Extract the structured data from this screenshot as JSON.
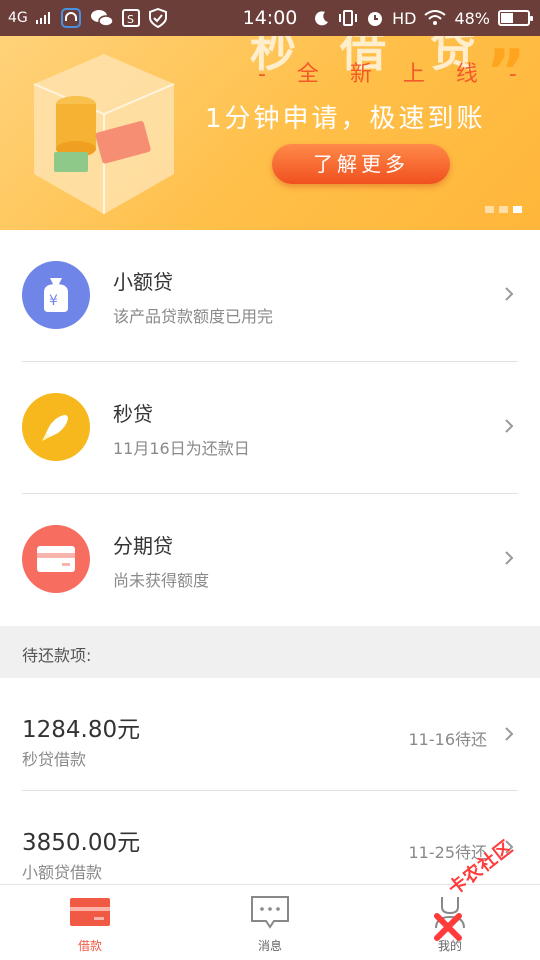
{
  "status_bar": {
    "network": "4G",
    "time": "14:00",
    "hd": "HD",
    "battery": "48%",
    "battery_level": 0.48
  },
  "banner": {
    "title_partial": "秒 借 贷",
    "subtitle": "- 全 新 上 线 -",
    "headline": "1分钟申请，极速到账",
    "button": "了解更多",
    "slides": 3,
    "active_slide": 3
  },
  "products": [
    {
      "name": "小额贷",
      "desc": "该产品贷款额度已用完",
      "icon": "money-bag-icon",
      "color": "#6f86e8"
    },
    {
      "name": "秒贷",
      "desc": "11月16日为还款日",
      "icon": "rocket-icon",
      "color": "#f6b81d"
    },
    {
      "name": "分期贷",
      "desc": "尚未获得额度",
      "icon": "card-icon",
      "color": "#f76d60"
    }
  ],
  "pending": {
    "heading": "待还款项:",
    "items": [
      {
        "amount": "1284.80元",
        "name": "秒贷借款",
        "date": "11-16待还"
      },
      {
        "amount": "3850.00元",
        "name": "小额贷借款",
        "date": "11-25待还"
      }
    ]
  },
  "tabs": [
    {
      "label": "借款",
      "icon": "borrow-icon",
      "active": true
    },
    {
      "label": "消息",
      "icon": "message-icon",
      "active": false
    },
    {
      "label": "我的",
      "icon": "profile-icon",
      "active": false
    }
  ],
  "watermark": "卡农社区",
  "colors": {
    "accent": "#f05a45",
    "banner": "#ffbf48",
    "status_bar": "#6b3e39"
  }
}
